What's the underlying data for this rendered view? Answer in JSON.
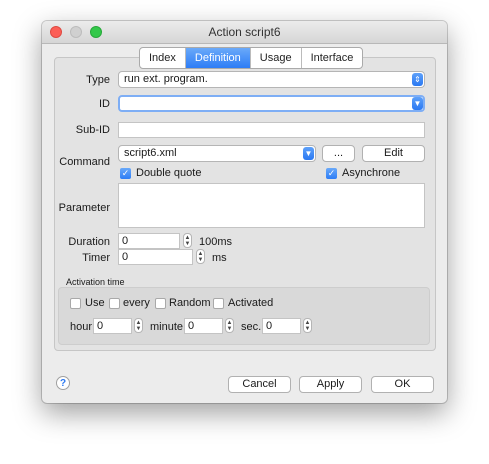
{
  "window": {
    "title": "Action script6"
  },
  "tabs": [
    {
      "label": "Index",
      "active": false
    },
    {
      "label": "Definition",
      "active": true
    },
    {
      "label": "Usage",
      "active": false
    },
    {
      "label": "Interface",
      "active": false
    }
  ],
  "form": {
    "type_label": "Type",
    "type_value": "run ext. program.",
    "id_label": "ID",
    "id_value": "",
    "subid_label": "Sub-ID",
    "subid_value": "",
    "command_label": "Command",
    "command_value": "script6.xml",
    "browse_label": "...",
    "edit_label": "Edit",
    "double_quote_label": "Double quote",
    "double_quote_checked": true,
    "asynchrone_label": "Asynchrone",
    "asynchrone_checked": true,
    "parameter_label": "Parameter",
    "parameter_value": "",
    "duration_label": "Duration",
    "duration_value": "0",
    "duration_unit": "100ms",
    "timer_label": "Timer",
    "timer_value": "0",
    "timer_unit": "ms"
  },
  "activation": {
    "group_label": "Activation time",
    "use_label": "Use",
    "every_label": "every",
    "random_label": "Random",
    "activated_label": "Activated",
    "hour_label": "hour",
    "hour_value": "0",
    "minute_label": "minute",
    "minute_value": "0",
    "sec_label": "sec.",
    "sec_value": "0"
  },
  "footer": {
    "help_label": "?",
    "cancel_label": "Cancel",
    "apply_label": "Apply",
    "ok_label": "OK"
  },
  "icons": {
    "chevron": "chevron-down-icon",
    "updown": "updown-arrows-icon",
    "check": "checkmark-icon"
  },
  "colors": {
    "accent": "#2d7df6",
    "close": "#fc5f57",
    "maximize": "#34c84a"
  }
}
